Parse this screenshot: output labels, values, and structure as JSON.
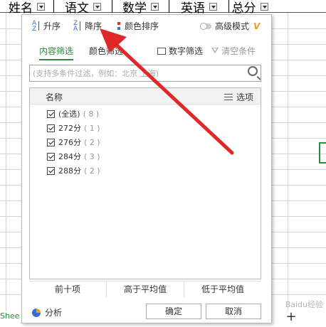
{
  "sheet": {
    "headers": [
      "姓名",
      "语文",
      "数学",
      "英语",
      "总分"
    ],
    "tab_label": "Shee",
    "add_tab": "+"
  },
  "toolbar": {
    "sort_asc": "升序",
    "sort_desc": "降序",
    "color_sort": "颜色排序",
    "advanced_mode": "高级模式",
    "vip_badge": "V"
  },
  "tabs": {
    "content_filter": "内容筛选",
    "color_filter": "颜色筛选",
    "number_filter": "数字筛选",
    "clear_filter": "清空条件"
  },
  "search": {
    "placeholder": "(支持多条件过滤，例如：北京 上海)"
  },
  "list": {
    "header_name": "名称",
    "header_options": "选项",
    "items": [
      {
        "label": "(全选)",
        "count": "( 8 )"
      },
      {
        "label": "272分",
        "count": "( 1 )"
      },
      {
        "label": "276分",
        "count": "( 2 )"
      },
      {
        "label": "284分",
        "count": "( 3 )"
      },
      {
        "label": "288分",
        "count": "( 2 )"
      }
    ]
  },
  "quick": {
    "top_ten": "前十项",
    "above_avg": "高于平均值",
    "below_avg": "低于平均值"
  },
  "footer": {
    "analyze": "分析",
    "ok": "确定",
    "cancel": "取消"
  },
  "watermark": "Baidu经验",
  "colors": {
    "accent_green": "#2c8a3f",
    "arrow_red": "#e02828",
    "vip_orange": "#e8a020"
  }
}
